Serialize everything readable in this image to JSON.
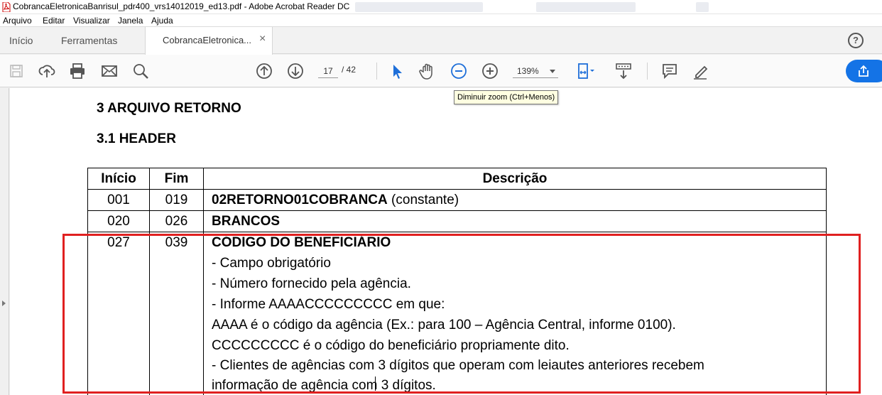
{
  "window": {
    "title": "CobrancaEletronicaBanrisul_pdr400_vrs14012019_ed13.pdf - Adobe Acrobat Reader DC"
  },
  "menu": {
    "items": [
      "Arquivo",
      "Editar",
      "Visualizar",
      "Janela",
      "Ajuda"
    ]
  },
  "tabs": {
    "home": "Início",
    "tools": "Ferramentas",
    "document": "CobrancaEletronica...",
    "close": "×",
    "help": "?"
  },
  "toolbar": {
    "page_current": "17",
    "page_total": "/ 42",
    "zoom": "139%",
    "tooltip": "Diminuir zoom (Ctrl+Menos)",
    "icons": [
      "save-icon",
      "upload-icon",
      "print-icon",
      "mail-icon",
      "search-zoom-icon",
      "page-up-icon",
      "page-down-icon",
      "select-arrow-icon",
      "hand-icon",
      "zoom-out-icon",
      "zoom-in-icon",
      "fit-page-icon",
      "scroll-mode-icon",
      "comment-icon",
      "highlight-pen-icon",
      "share-icon"
    ]
  },
  "document": {
    "heading": "3 ARQUIVO RETORNO",
    "subheading": "3.1 HEADER",
    "table": {
      "headers": [
        "Início",
        "Fim",
        "Descrição"
      ],
      "rows": [
        {
          "start": "001",
          "end": "019",
          "desc_bold": "02RETORNO01COBRANCA",
          "desc_rest": " (constante)"
        },
        {
          "start": "020",
          "end": "026",
          "desc_bold": "BRANCOS",
          "desc_rest": ""
        },
        {
          "start": "027",
          "end": "039",
          "desc_bold": "CÓDIGO DO BENEFICIÁRIO",
          "lines": [
            "- Campo obrigatório",
            "- Número fornecido pela agência.",
            "- Informe AAAACCCCCCCCC em que:",
            "AAAA é o código da agência (Ex.: para 100 – Agência Central, informe 0100).",
            "CCCCCCCCC é o código do beneficiário propriamente dito.",
            "- Clientes de agências com 3 dígitos que operam com leiautes anteriores recebem",
            "informação de agência com 3 dígitos."
          ]
        }
      ]
    }
  },
  "colors": {
    "highlight_border": "#e02020",
    "accent": "#1473e6",
    "toolbar_icon": "#1e6fd9"
  }
}
